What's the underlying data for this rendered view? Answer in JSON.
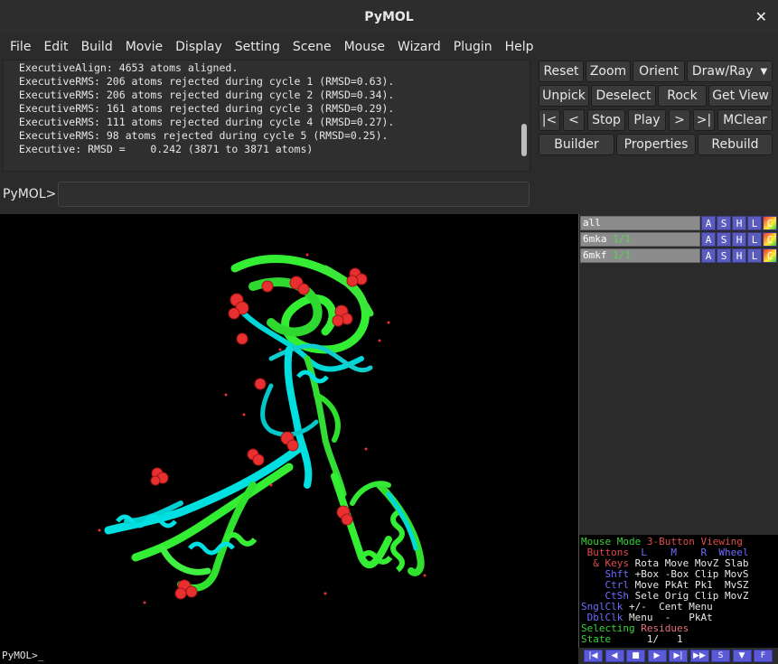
{
  "window": {
    "title": "PyMOL",
    "close_glyph": "✕"
  },
  "menu": [
    "File",
    "Edit",
    "Build",
    "Movie",
    "Display",
    "Setting",
    "Scene",
    "Mouse",
    "Wizard",
    "Plugin",
    "Help"
  ],
  "log": {
    "lines": [
      " ExecutiveAlign: 4653 atoms aligned.",
      " ExecutiveRMS: 206 atoms rejected during cycle 1 (RMSD=0.63).",
      " ExecutiveRMS: 206 atoms rejected during cycle 2 (RMSD=0.34).",
      " ExecutiveRMS: 161 atoms rejected during cycle 3 (RMSD=0.29).",
      " ExecutiveRMS: 111 atoms rejected during cycle 4 (RMSD=0.27).",
      " ExecutiveRMS: 98 atoms rejected during cycle 5 (RMSD=0.25).",
      " Executive: RMSD =    0.242 (3871 to 3871 atoms)"
    ]
  },
  "command": {
    "prompt": "PyMOL>",
    "value": ""
  },
  "buttons": {
    "reset": "Reset",
    "zoom": "Zoom",
    "orient": "Orient",
    "draw_ray": "Draw/Ray",
    "unpick": "Unpick",
    "deselect": "Deselect",
    "rock": "Rock",
    "get_view": "Get View",
    "rewind": "|<",
    "back": "<",
    "stop": "Stop",
    "play": "Play",
    "forward": ">",
    "end": ">|",
    "mclear": "MClear",
    "builder": "Builder",
    "properties": "Properties",
    "rebuild": "Rebuild"
  },
  "objects": [
    {
      "name": "all",
      "state": ""
    },
    {
      "name": "6mka",
      "state": "1/1"
    },
    {
      "name": "6mkf",
      "state": "1/1"
    }
  ],
  "object_buttons": [
    "A",
    "S",
    "H",
    "L",
    "C"
  ],
  "mouse_panel": {
    "mode_label": "Mouse Mode",
    "mode_value": "3-Button Viewing",
    "buttons_label": "Buttons",
    "btn_L": "L",
    "btn_M": "M",
    "btn_R": "R",
    "btn_wheel": "Wheel",
    "keys_label": "& Keys",
    "rows": [
      {
        "key": "",
        "vals": "Rota Move MovZ Slab"
      },
      {
        "key": "Shft",
        "vals": "+Box -Box Clip MovS"
      },
      {
        "key": "Ctrl",
        "vals": "Move PkAt Pk1  MvSZ"
      },
      {
        "key": "CtSh",
        "vals": "Sele Orig Clip MovZ"
      },
      {
        "key": "SnglClk",
        "vals": "+/-  Cent Menu"
      },
      {
        "key": "DblClk",
        "vals": "Menu  -   PkAt"
      }
    ],
    "selecting_label": "Selecting",
    "selecting_value": "Residues",
    "state_label": "State",
    "state_value": "1/   1"
  },
  "status_line": "PyMOL>_",
  "playback": [
    "|◀",
    "◀",
    "■",
    "▶",
    "▶|",
    "▶▶",
    "S",
    "▼",
    "F"
  ],
  "colors": {
    "cyan": "#00e0e0",
    "green": "#33ee33",
    "sphere": "#e83030",
    "accent_blue": "#5c5cbf"
  }
}
